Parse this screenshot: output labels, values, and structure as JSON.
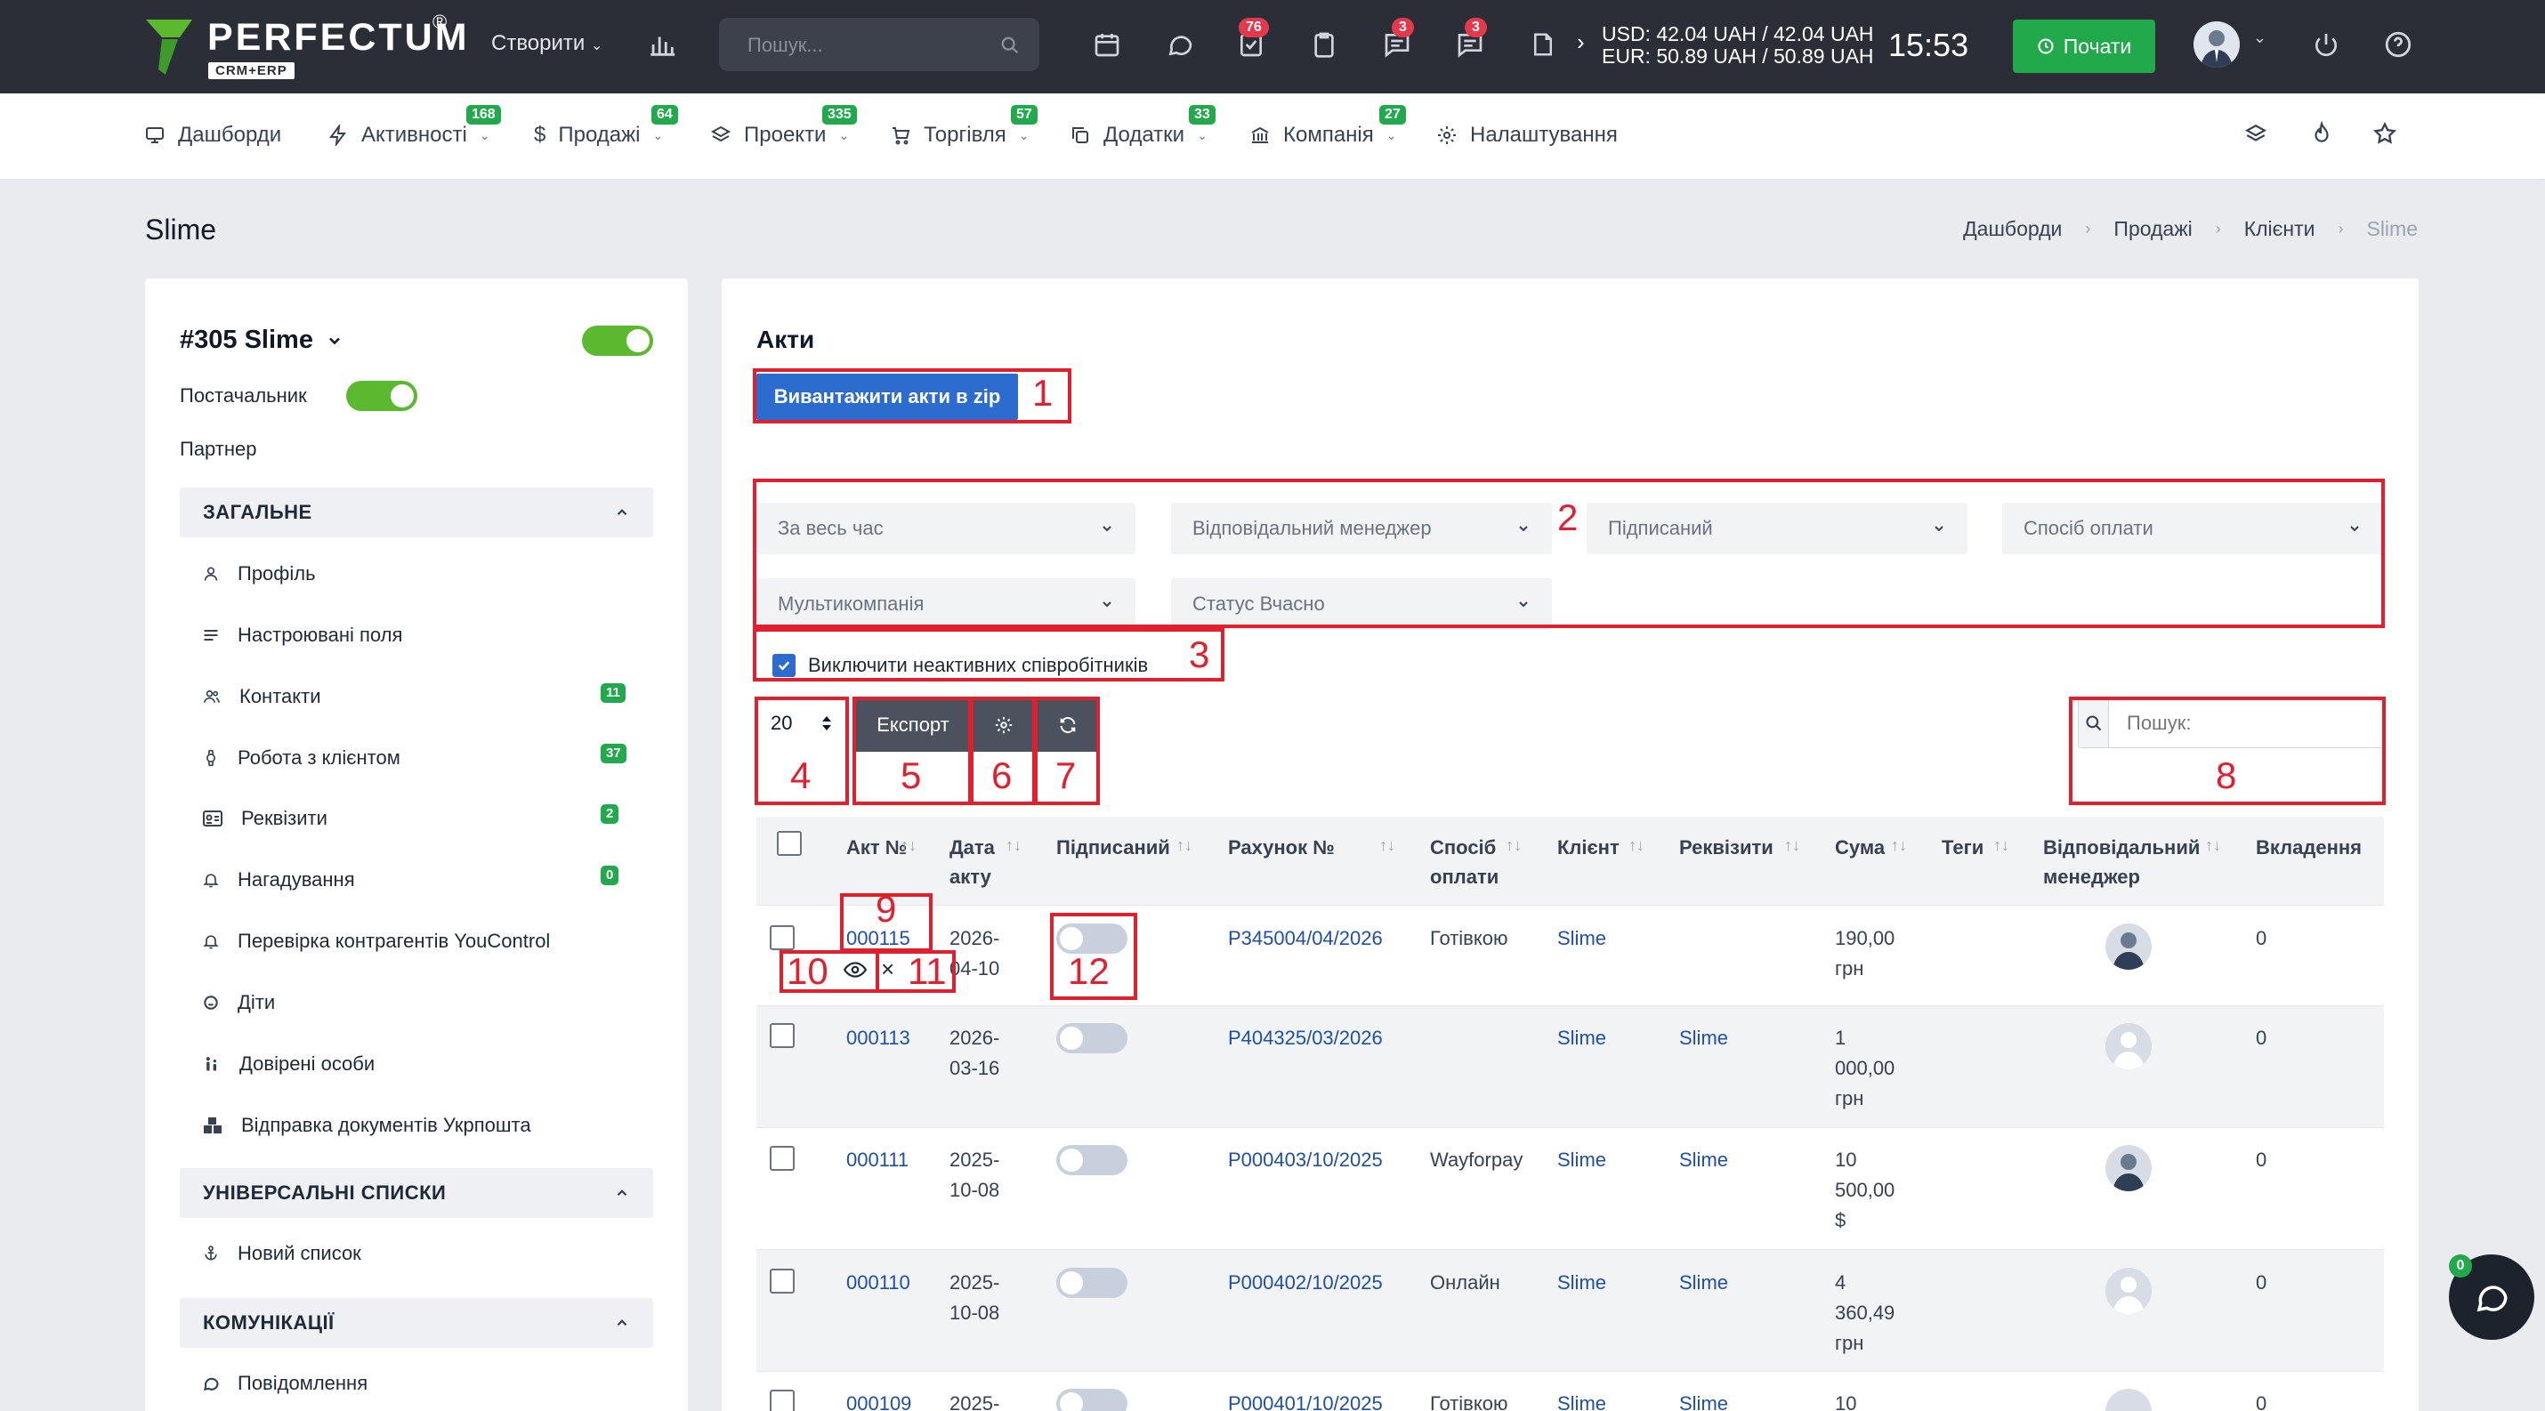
{
  "topbar": {
    "logo": "PERFECTUM",
    "logo_sub": "CRM+ERP",
    "logo_reg": "®",
    "create_label": "Створити",
    "search_placeholder": "Пошук...",
    "badges": {
      "tasks": "76",
      "chat": "3",
      "messages": "3"
    },
    "usd": "USD: 42.04 UAH / 42.04 UAH",
    "eur": "EUR: 50.89 UAH / 50.89 UAH",
    "time": "15:53",
    "start_label": "Почати"
  },
  "menu": [
    {
      "label": "Дашборди",
      "icon": "monitor-icon",
      "badge": ""
    },
    {
      "label": "Активності",
      "icon": "bolt-icon",
      "badge": "168"
    },
    {
      "label": "Продажі",
      "icon": "dollar-icon",
      "badge": "64"
    },
    {
      "label": "Проекти",
      "icon": "layers-icon",
      "badge": "335"
    },
    {
      "label": "Торгівля",
      "icon": "cart-icon",
      "badge": "57"
    },
    {
      "label": "Додатки",
      "icon": "copy-icon",
      "badge": "33"
    },
    {
      "label": "Компанія",
      "icon": "bank-icon",
      "badge": "27"
    },
    {
      "label": "Налаштування",
      "icon": "gear-icon",
      "badge": ""
    }
  ],
  "page": {
    "title": "Slime",
    "breadcrumbs": [
      "Дашборди",
      "Продажі",
      "Клієнти",
      "Slime"
    ]
  },
  "client": {
    "heading": "#305 Slime",
    "supplier_label": "Постачальник",
    "partner_label": "Партнер"
  },
  "sections": {
    "general": "ЗАГАЛЬНЕ",
    "lists": "УНІВЕРСАЛЬНІ СПИСКИ",
    "comms": "КОМУНІКАЦІЇ"
  },
  "nav": [
    {
      "label": "Профіль",
      "count": ""
    },
    {
      "label": "Настроювані поля",
      "count": ""
    },
    {
      "label": "Контакти",
      "count": "11"
    },
    {
      "label": "Робота з клієнтом",
      "count": "37"
    },
    {
      "label": "Реквізити",
      "count": "2"
    },
    {
      "label": "Нагадування",
      "count": "0"
    },
    {
      "label": "Перевірка контрагентів YouControl",
      "count": ""
    },
    {
      "label": "Діти",
      "count": ""
    },
    {
      "label": "Довірені особи",
      "count": ""
    },
    {
      "label": "Відправка документів Укрпошта",
      "count": ""
    }
  ],
  "nav_lists": [
    {
      "label": "Новий список"
    }
  ],
  "nav_comms": [
    {
      "label": "Повідомлення"
    }
  ],
  "acts": {
    "title": "Акти",
    "zip_button": "Вивантажити акти в zip",
    "filters": [
      "За весь час",
      "Відповідальний менеджер",
      "Підписаний",
      "Спосіб оплати",
      "Мультикомпанія",
      "Статус Вчасно"
    ],
    "exclude_inactive": "Виключити неактивних співробітників",
    "page_size": "20",
    "export_label": "Експорт",
    "search_placeholder": "Пошук:",
    "columns": [
      "Акт №",
      "Дата акту",
      "Підписаний",
      "Рахунок №",
      "Спосіб оплати",
      "Клієнт",
      "Реквізити",
      "Сума",
      "Теги",
      "Відповідальний менеджер",
      "Вкладення"
    ],
    "rows": [
      {
        "num": "000115",
        "date": "2026-04-10",
        "invoice": "Р345004/04/2026",
        "payment": "Готівкою",
        "client": "Slime",
        "requisites": "",
        "sum": "190,00 грн",
        "attachments": "0"
      },
      {
        "num": "000113",
        "date": "2026-03-16",
        "invoice": "Р404325/03/2026",
        "payment": "",
        "client": "Slime",
        "requisites": "Slime",
        "sum": "1 000,00 грн",
        "attachments": "0"
      },
      {
        "num": "000111",
        "date": "2025-10-08",
        "invoice": "Р000403/10/2025",
        "payment": "Wayforpay",
        "client": "Slime",
        "requisites": "Slime",
        "sum": "10 500,00 $",
        "attachments": "0"
      },
      {
        "num": "000110",
        "date": "2025-10-08",
        "invoice": "Р000402/10/2025",
        "payment": "Онлайн",
        "client": "Slime",
        "requisites": "Slime",
        "sum": "4 360,49 грн",
        "attachments": "0"
      },
      {
        "num": "000109",
        "date": "2025-",
        "invoice": "Р000401/10/2025",
        "payment": "Готівкою",
        "client": "Slime",
        "requisites": "Slime",
        "sum": "10",
        "attachments": "0"
      }
    ]
  },
  "annotations": [
    "1",
    "2",
    "3",
    "4",
    "5",
    "6",
    "7",
    "8",
    "9",
    "10",
    "11",
    "12"
  ],
  "chat_badge": "0",
  "colors": {
    "accent_blue": "#2d6ccf",
    "green": "#22a94b",
    "badge_red": "#e3394c",
    "annotation_red": "#e0202e",
    "topbar": "#2b2e36"
  }
}
